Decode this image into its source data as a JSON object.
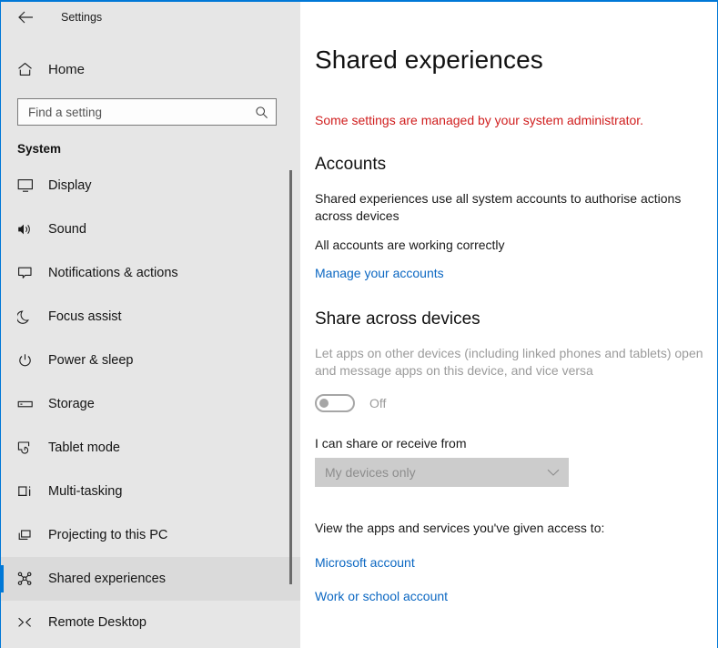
{
  "window": {
    "accent_color": "#0078d7",
    "sidebar_bg": "#e6e6e6",
    "link_color": "#0b67c2",
    "warning_color": "#d01e1e"
  },
  "titlebar": {
    "back_icon": "back-arrow-icon",
    "title": "Settings"
  },
  "sidebar": {
    "home": {
      "icon": "home-icon",
      "label": "Home"
    },
    "search": {
      "icon": "search-icon",
      "placeholder": "Find a setting",
      "value": ""
    },
    "group_title": "System",
    "items": [
      {
        "icon": "monitor-icon",
        "label": "Display",
        "selected": false
      },
      {
        "icon": "speaker-icon",
        "label": "Sound",
        "selected": false
      },
      {
        "icon": "notification-icon",
        "label": "Notifications & actions",
        "selected": false
      },
      {
        "icon": "moon-icon",
        "label": "Focus assist",
        "selected": false
      },
      {
        "icon": "power-icon",
        "label": "Power & sleep",
        "selected": false
      },
      {
        "icon": "drive-icon",
        "label": "Storage",
        "selected": false
      },
      {
        "icon": "tablet-icon",
        "label": "Tablet mode",
        "selected": false
      },
      {
        "icon": "multitask-icon",
        "label": "Multi-tasking",
        "selected": false
      },
      {
        "icon": "projecting-icon",
        "label": "Projecting to this PC",
        "selected": false
      },
      {
        "icon": "shared-experiences-icon",
        "label": "Shared experiences",
        "selected": true
      },
      {
        "icon": "remote-desktop-icon",
        "label": "Remote Desktop",
        "selected": false
      }
    ]
  },
  "main": {
    "page_title": "Shared experiences",
    "admin_note": "Some settings are managed by your system administrator.",
    "accounts": {
      "heading": "Accounts",
      "description": "Shared experiences use all system accounts to authorise actions across devices",
      "status": "All accounts are working correctly",
      "manage_link": "Manage your accounts"
    },
    "share_across_devices": {
      "heading": "Share across devices",
      "description": "Let apps on other devices (including linked phones and tablets) open and message apps on this device, and vice versa",
      "toggle_state": "Off",
      "toggle_enabled": false,
      "field_label": "I can share or receive from",
      "dropdown_value": "My devices only",
      "dropdown_icon": "chevron-down-icon"
    },
    "access": {
      "intro": "View the apps and services you've given access to:",
      "links": [
        "Microsoft account",
        "Work or school account"
      ]
    }
  }
}
